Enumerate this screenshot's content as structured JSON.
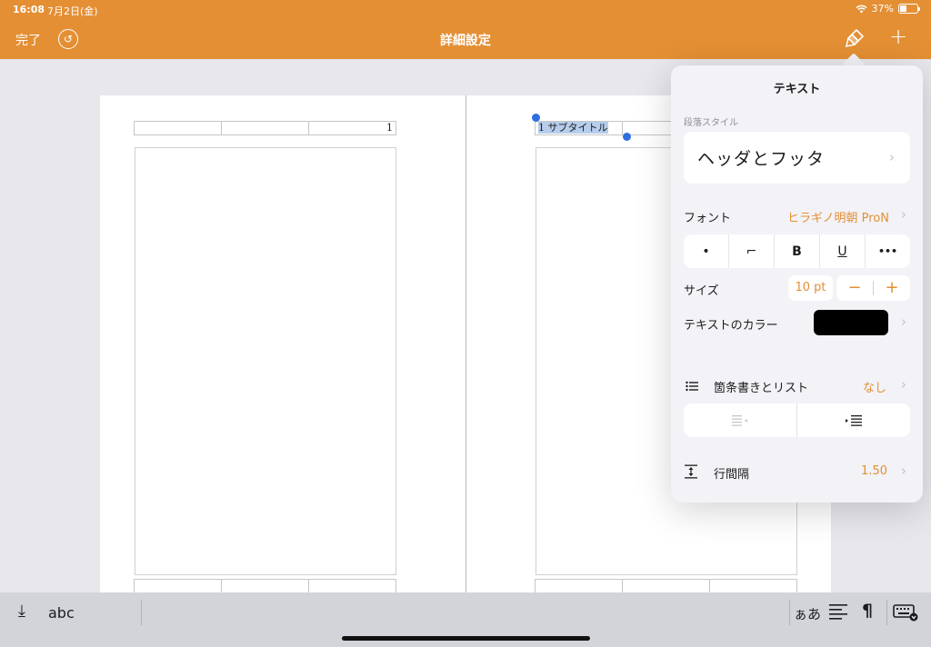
{
  "status": {
    "time": "16:08",
    "date": "7月2日(金)",
    "battery": "37%",
    "battery_level": 0.37
  },
  "nav": {
    "done": "完了",
    "title": "詳細設定"
  },
  "document": {
    "left_header_cells": [
      "",
      "",
      "1"
    ],
    "right_header_cells": [
      "1 サブタイトル",
      "",
      ""
    ]
  },
  "popover": {
    "title": "テキスト",
    "paragraph_style_label": "段落スタイル",
    "paragraph_style": "ヘッダとフッタ",
    "font_label": "フォント",
    "font_value": "ヒラギノ明朝 ProN",
    "format_buttons": [
      "•",
      "⌐",
      "B",
      "U",
      "•••"
    ],
    "size_label": "サイズ",
    "size_value": "10 pt",
    "minus": "−",
    "plus": "+",
    "text_color_label": "テキストのカラー",
    "text_color": "#000000",
    "list_label": "箇条書きとリスト",
    "list_value": "なし",
    "line_spacing_label": "行間隔",
    "line_spacing_value": "1.50"
  },
  "bottombar": {
    "abc": "abc",
    "kana": "ぁあ",
    "pilcrow": "¶"
  },
  "colors": {
    "accent": "#e48f34",
    "selection": "#b6cdec",
    "handle": "#2f6fe0"
  }
}
